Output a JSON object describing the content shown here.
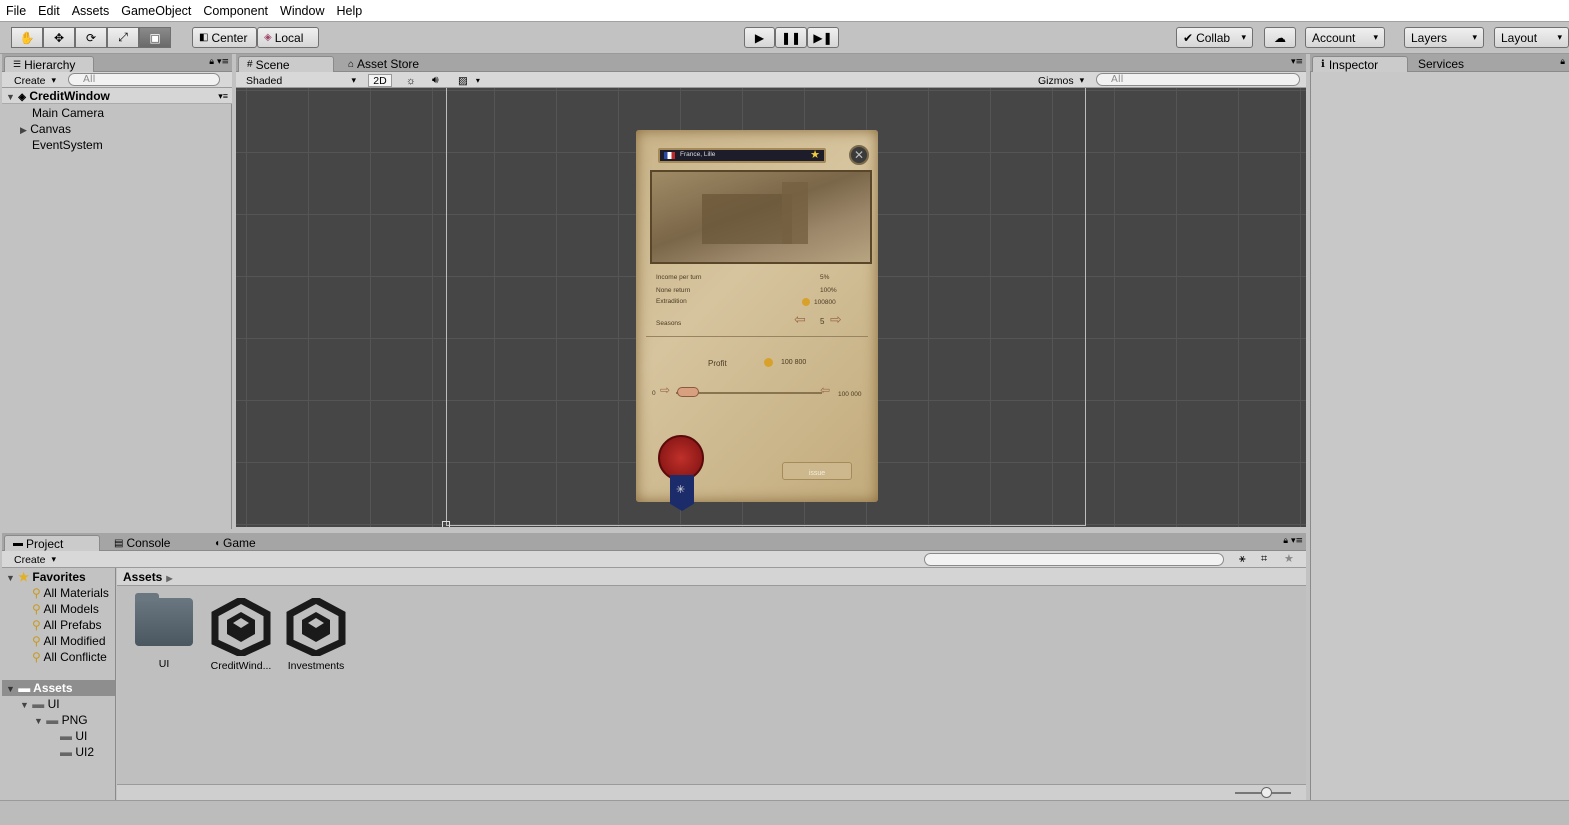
{
  "menu": [
    "File",
    "Edit",
    "Assets",
    "GameObject",
    "Component",
    "Window",
    "Help"
  ],
  "toolbar": {
    "tools": [
      "hand-icon",
      "move-icon",
      "rotate-icon",
      "scale-icon",
      "rect-tool-icon"
    ],
    "pivot": "Center",
    "space": "Local",
    "collab": "Collab",
    "account": "Account",
    "layers": "Layers",
    "layout": "Layout"
  },
  "hierarchy": {
    "tab": "Hierarchy",
    "create": "Create",
    "search_placeholder": "All",
    "scene_name": "CreditWindow",
    "items": [
      "Main Camera",
      "Canvas",
      "EventSystem"
    ]
  },
  "scene": {
    "tabs": [
      "Scene",
      "Asset Store"
    ],
    "shading": "Shaded",
    "mode_2d": "2D",
    "gizmos": "Gizmos",
    "search_placeholder": "All"
  },
  "credit_window": {
    "location": "France, Lille",
    "rows": [
      {
        "label": "Income per turn",
        "value": "5%"
      },
      {
        "label": "None return",
        "value": "100%"
      },
      {
        "label": "Extradition",
        "value": "100800"
      },
      {
        "label": "Seasons",
        "value": "5"
      }
    ],
    "profit_label": "Profit",
    "profit_value": "100 800",
    "slider_min": "0",
    "slider_max": "100 000",
    "issue_button": "issue"
  },
  "inspector": {
    "tabs": [
      "Inspector",
      "Services"
    ]
  },
  "bottom": {
    "tabs": [
      "Project",
      "Console",
      "Game"
    ],
    "create": "Create",
    "favorites_title": "Favorites",
    "favorites": [
      "All Materials",
      "All Models",
      "All Prefabs",
      "All Modified",
      "All Conflicte"
    ],
    "assets_title": "Assets",
    "tree": [
      "UI",
      "PNG",
      "UI",
      "UI2"
    ],
    "breadcrumb": "Assets",
    "assets": [
      {
        "name": "UI",
        "icon": "folder-icon"
      },
      {
        "name": "CreditWind...",
        "icon": "unity-scene-icon"
      },
      {
        "name": "Investments",
        "icon": "unity-scene-icon"
      }
    ]
  }
}
